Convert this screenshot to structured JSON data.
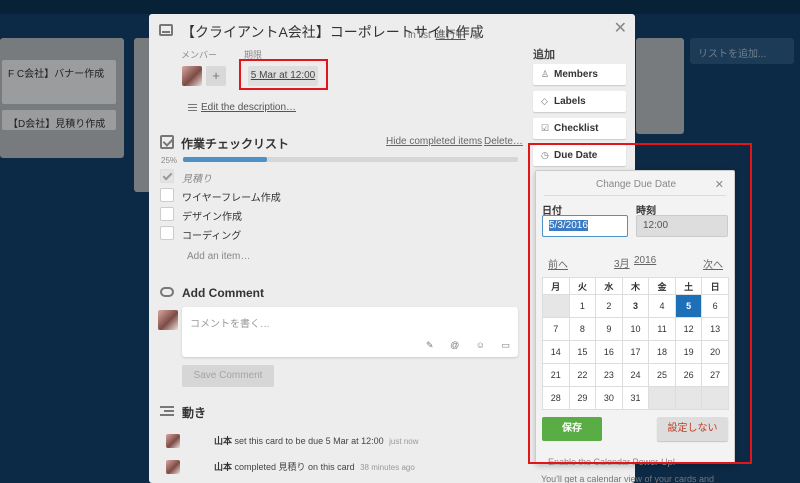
{
  "board": {
    "lists": [
      {
        "cards": [
          "F C会社】バナー作成",
          "【D会社】見積り作成"
        ]
      },
      {
        "cards": []
      },
      {
        "cards": []
      }
    ],
    "add_list_label": "リストを追加..."
  },
  "card": {
    "title": "【クライアントA会社】コーポレートサイト作成",
    "in_list_prefix": "in list",
    "list_name": "進行中",
    "members_label": "メンバー",
    "due_label": "期限",
    "due_value": "5 Mar at 12:00",
    "edit_description": "Edit the description…"
  },
  "checklist": {
    "title": "作業チェックリスト",
    "hide_label": "Hide completed items",
    "delete_label": "Delete…",
    "progress_label": "25%",
    "progress": 0.25,
    "items": [
      {
        "text": "見積り",
        "done": true
      },
      {
        "text": "ワイヤーフレーム作成",
        "done": false
      },
      {
        "text": "デザイン作成",
        "done": false
      },
      {
        "text": "コーディング",
        "done": false
      }
    ],
    "add_item_label": "Add an item…"
  },
  "comment": {
    "title": "Add Comment",
    "placeholder": "コメントを書く…",
    "save_label": "Save Comment"
  },
  "activity": {
    "title": "動き",
    "entries": [
      {
        "user": "山本",
        "text": "set this card to be due 5 Mar at 12:00",
        "time": "just now"
      },
      {
        "user": "山本",
        "text": "completed 見積り on this card",
        "time": "38 minutes ago"
      }
    ]
  },
  "sidebar": {
    "add_header": "追加",
    "buttons": [
      {
        "label": "Members",
        "icon": "person-icon"
      },
      {
        "label": "Labels",
        "icon": "label-icon"
      },
      {
        "label": "Checklist",
        "icon": "checkbox-icon"
      },
      {
        "label": "Due Date",
        "icon": "clock-icon"
      }
    ]
  },
  "due_popover": {
    "title": "Change Due Date",
    "date_label": "日付",
    "time_label": "時刻",
    "date_value": "5/3/2016",
    "time_value": "12:00",
    "prev_label": "前へ",
    "month_label": "3月",
    "year_label": "2016",
    "next_label": "次へ",
    "weekdays": [
      "月",
      "火",
      "水",
      "木",
      "金",
      "土",
      "日"
    ],
    "weeks": [
      [
        "",
        "1",
        "2",
        "3",
        "4",
        "5",
        "6"
      ],
      [
        "7",
        "8",
        "9",
        "10",
        "11",
        "12",
        "13"
      ],
      [
        "14",
        "15",
        "16",
        "17",
        "18",
        "19",
        "20"
      ],
      [
        "21",
        "22",
        "23",
        "24",
        "25",
        "26",
        "27"
      ],
      [
        "28",
        "29",
        "30",
        "31",
        "",
        "",
        ""
      ]
    ],
    "selected_day": "5",
    "today_day": "3",
    "save_label": "保存",
    "remove_label": "設定しない",
    "power_up_text": "Enable the Calendar Power-Up!",
    "power_up_desc": "You'll get a calendar view of your cards and"
  },
  "colors": {
    "highlight": "#e3151a",
    "accent": "#1d70b8",
    "save": "#5aac44"
  }
}
